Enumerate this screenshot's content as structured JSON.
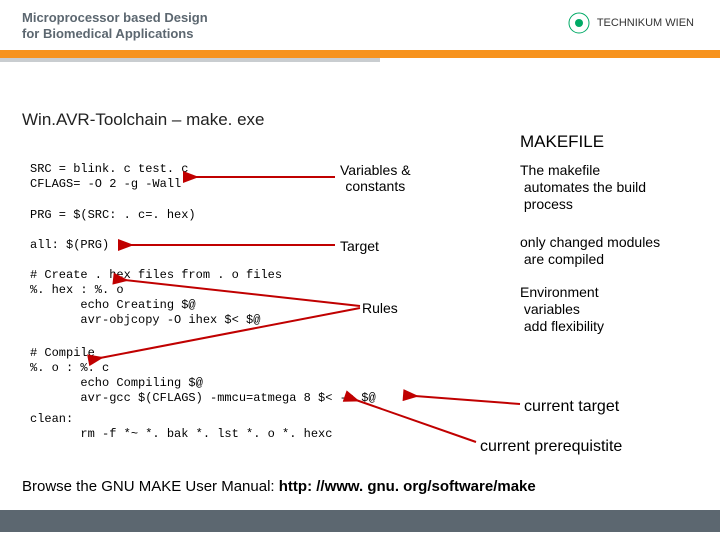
{
  "header": {
    "title_l1": "Microprocessor based Design",
    "title_l2": "for Biomedical Applications",
    "logo_text": "TECHNIKUM WIEN"
  },
  "section_title": "Win.AVR-Toolchain – make. exe",
  "makefile_heading": "MAKEFILE",
  "code": {
    "block1": "SRC = blink. c test. c\nCFLAGS= -O 2 -g -Wall",
    "block2": "PRG = $(SRC: . c=. hex)",
    "block3": "all: $(PRG)",
    "block4": "# Create . hex files from . o files\n%. hex : %. o\n       echo Creating $@\n       avr-objcopy -O ihex $< $@",
    "block5": "# Compile\n%. o : %. c\n       echo Compiling $@\n       avr-gcc $(CFLAGS) -mmcu=atmega 8 $< -o $@",
    "block6": "clean:\n       rm -f *~ *. bak *. lst *. o *. hexc"
  },
  "labels": {
    "variables_l1": "Variables &",
    "variables_l2": "constants",
    "target": "Target",
    "rules": "Rules",
    "current_target": "current target",
    "current_prereq": "current prerequistite"
  },
  "right": {
    "para1_l1": "The makefile",
    "para1_l2": "automates the build",
    "para1_l3": "process",
    "para2_l1": "only changed modules",
    "para2_l2": "are compiled",
    "para3_l1": "Environment",
    "para3_l2": "variables",
    "para3_l3": "add flexibility"
  },
  "footer": {
    "prefix": "Browse the GNU MAKE User Manual: ",
    "url": "http: //www. gnu. org/software/make"
  },
  "colors": {
    "arrow": "#c00000"
  }
}
